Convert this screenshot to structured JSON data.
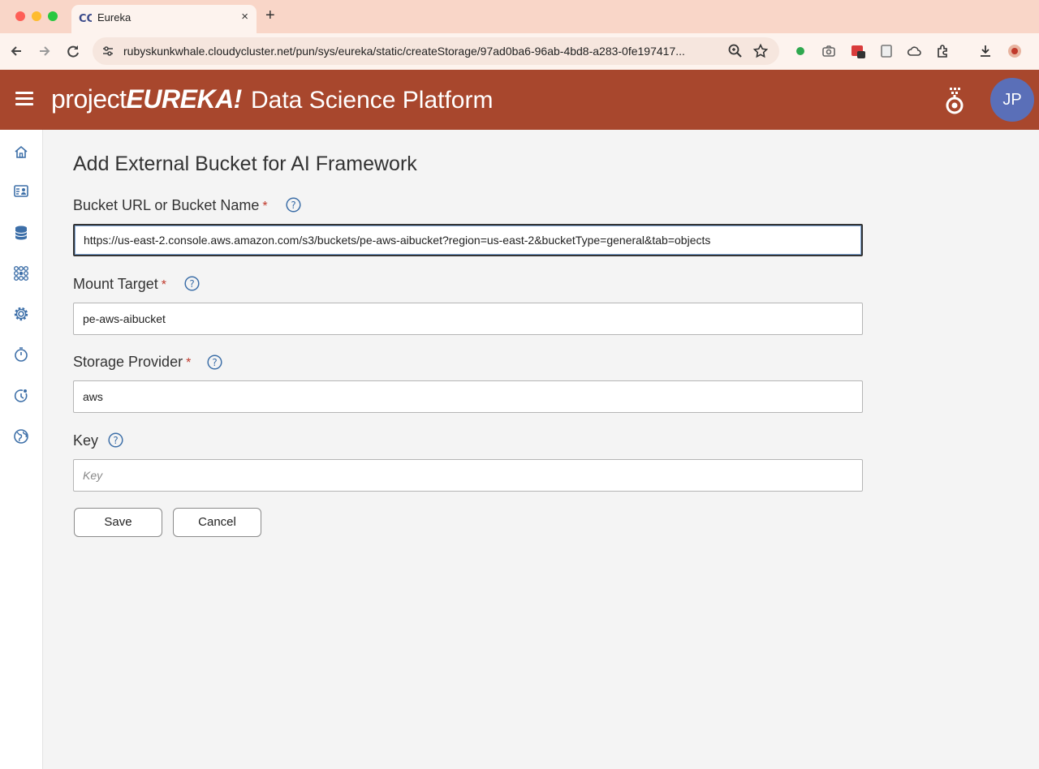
{
  "browser": {
    "tab_title": "Eureka",
    "tab_close": "×",
    "new_tab": "+",
    "url": "rubyskunkwhale.cloudycluster.net/pun/sys/eureka/static/createStorage/97ad0ba6-96ab-4bd8-a283-0fe197417...",
    "colors": {
      "tabbar": "#f9d6c8",
      "toolbar": "#fdf3ee"
    }
  },
  "app": {
    "brand_project": "project",
    "brand_eureka": "EUREKA!",
    "subtitle": "Data Science Platform",
    "avatar_initials": "JP",
    "colors": {
      "header": "#a8472d",
      "avatar": "#5a6fb8"
    }
  },
  "sidenav": {
    "items": [
      {
        "icon": "home-icon"
      },
      {
        "icon": "user-card-icon"
      },
      {
        "icon": "database-icon"
      },
      {
        "icon": "cluster-icon"
      },
      {
        "icon": "gear-icon"
      },
      {
        "icon": "timer-icon"
      },
      {
        "icon": "history-icon"
      },
      {
        "icon": "globe-icon"
      }
    ]
  },
  "form": {
    "title": "Add External Bucket for AI Framework",
    "required_mark": "*",
    "bucket_url": {
      "label": "Bucket URL or Bucket Name",
      "value": "https://us-east-2.console.aws.amazon.com/s3/buckets/pe-aws-aibucket?region=us-east-2&bucketType=general&tab=objects"
    },
    "mount_target": {
      "label": "Mount Target",
      "value": "pe-aws-aibucket"
    },
    "storage_provider": {
      "label": "Storage Provider",
      "value": "aws"
    },
    "key": {
      "label": "Key",
      "placeholder": "Key",
      "value": ""
    },
    "save_label": "Save",
    "cancel_label": "Cancel"
  }
}
